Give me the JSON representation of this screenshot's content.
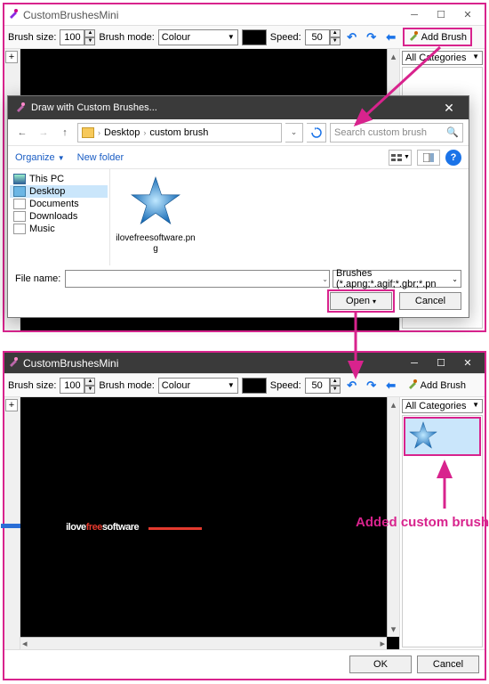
{
  "app": {
    "title": "CustomBrushesMini",
    "brush_size_label": "Brush size:",
    "brush_size_value": "100",
    "brush_mode_label": "Brush mode:",
    "brush_mode_value": "Colour",
    "speed_label": "Speed:",
    "speed_value": "50",
    "add_brush_label": "Add Brush",
    "categories_label": "All Categories",
    "ok_label": "OK",
    "cancel_label": "Cancel"
  },
  "dialog": {
    "title": "Draw with Custom Brushes...",
    "crumb_desktop": "Desktop",
    "crumb_folder": "custom brush",
    "search_placeholder": "Search custom brush",
    "organize_label": "Organize",
    "newfolder_label": "New folder",
    "tree": {
      "pc": "This PC",
      "desktop": "Desktop",
      "documents": "Documents",
      "downloads": "Downloads",
      "music": "Music"
    },
    "file_name": "ilovefreesoftware.png",
    "filename_label": "File name:",
    "filter_value": "Brushes (*.apng;*.agif;*.gbr;*.pn",
    "open_label": "Open",
    "cancel_label": "Cancel"
  },
  "canvas2_text": {
    "pre": "ilove",
    "red": "free",
    "post": "software"
  },
  "annotation": "Added custom brush",
  "colors": {
    "highlight": "#d8238d",
    "accent": "#1a73e8"
  }
}
